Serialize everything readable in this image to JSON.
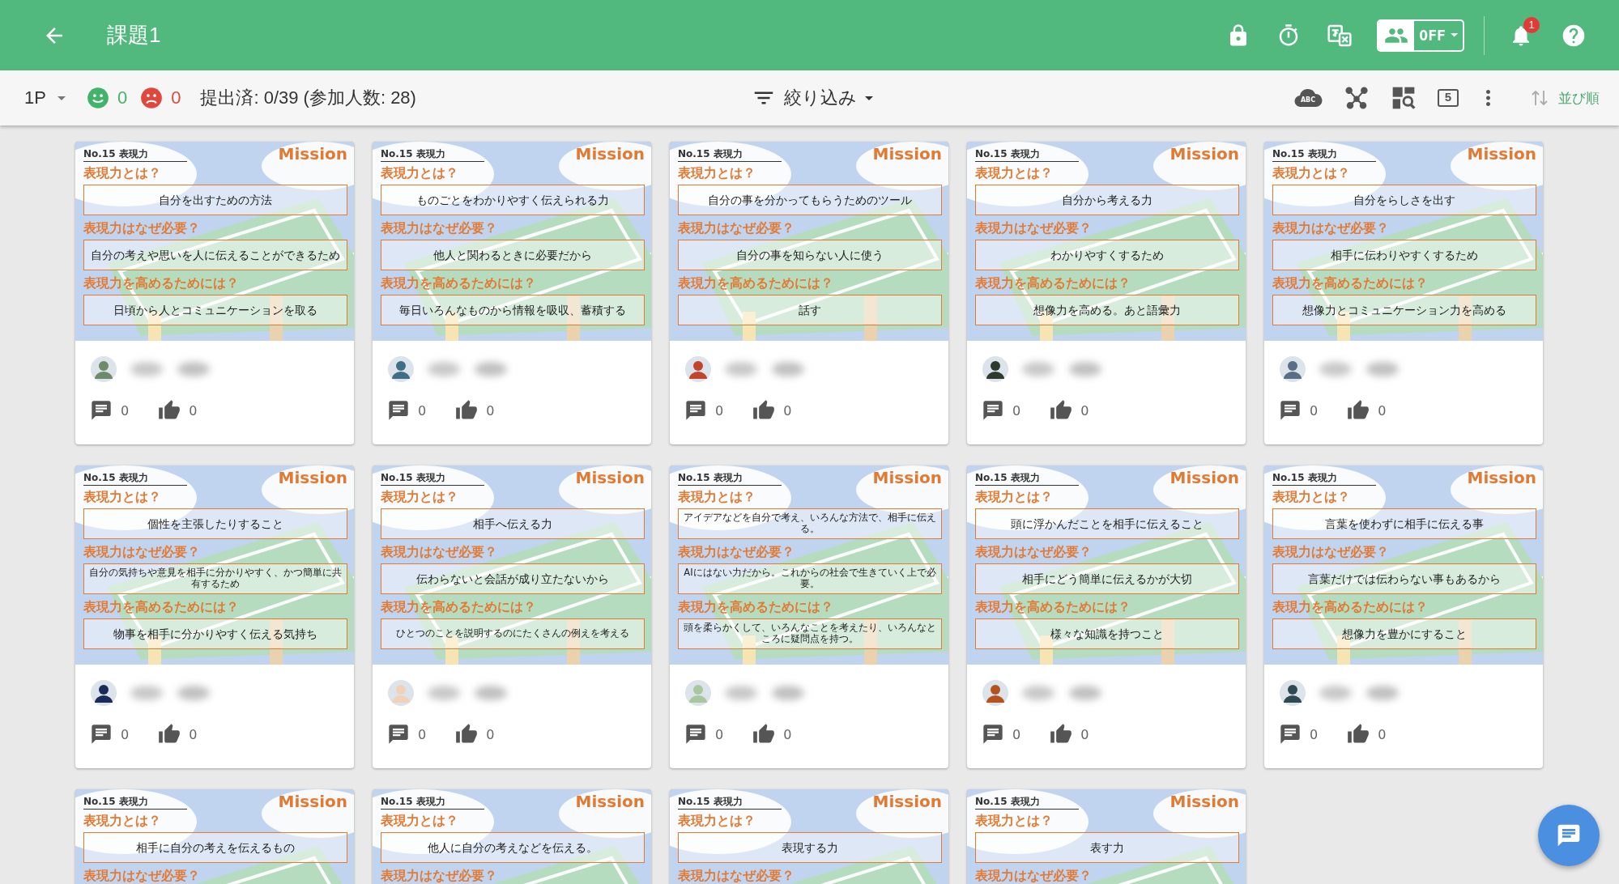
{
  "header": {
    "title": "課題1",
    "share_toggle": "OFF",
    "notification_count": "1"
  },
  "toolbar": {
    "page": "1P",
    "good_count": "0",
    "bad_count": "0",
    "submitted": "提出済: 0/39 (参加人数: 28)",
    "filter": "絞り込み",
    "spellcheck_label": "ABC",
    "columns_count": "5",
    "sort": "並び順"
  },
  "cards": [
    {
      "number": "No.15 表現力",
      "badge": "Mission",
      "sections": [
        {
          "question": "表現力とは？",
          "answer": "自分を出すための方法"
        },
        {
          "question": "表現力はなぜ必要？",
          "answer": "自分の考えや思いを人に伝えることができるため"
        },
        {
          "question": "表現力を高めるためには？",
          "answer": "日頃から人とコミュニケーションを取る"
        }
      ],
      "comments": "0",
      "likes": "0"
    },
    {
      "number": "No.15 表現力",
      "badge": "Mission",
      "sections": [
        {
          "question": "表現力とは？",
          "answer": "ものごとをわかりやすく伝えられる力"
        },
        {
          "question": "表現力はなぜ必要？",
          "answer": "他人と関わるときに必要だから"
        },
        {
          "question": "表現力を高めるためには？",
          "answer": "毎日いろんなものから情報を吸収、蓄積する"
        }
      ],
      "comments": "0",
      "likes": "0"
    },
    {
      "number": "No.15 表現力",
      "badge": "Mission",
      "sections": [
        {
          "question": "表現力とは？",
          "answer": "自分の事を分かってもらうためのツール"
        },
        {
          "question": "表現力はなぜ必要？",
          "answer": "自分の事を知らない人に使う"
        },
        {
          "question": "表現力を高めるためには？",
          "answer": "話す"
        }
      ],
      "comments": "0",
      "likes": "0"
    },
    {
      "number": "No.15 表現力",
      "badge": "Mission",
      "sections": [
        {
          "question": "表現力とは？",
          "answer": "自分から考える力"
        },
        {
          "question": "表現力はなぜ必要？",
          "answer": "わかりやすくするため"
        },
        {
          "question": "表現力を高めるためには？",
          "answer": "想像力を高める。あと語彙力"
        }
      ],
      "comments": "0",
      "likes": "0"
    },
    {
      "number": "No.15 表現力",
      "badge": "Mission",
      "sections": [
        {
          "question": "表現力とは？",
          "answer": "自分をらしさを出す"
        },
        {
          "question": "表現力はなぜ必要？",
          "answer": "相手に伝わりやすくするため"
        },
        {
          "question": "表現力を高めるためには？",
          "answer": "想像力とコミュニケーション力を高める"
        }
      ],
      "comments": "0",
      "likes": "0"
    },
    {
      "number": "No.15 表現力",
      "badge": "Mission",
      "sections": [
        {
          "question": "表現力とは？",
          "answer": "個性を主張したりすること"
        },
        {
          "question": "表現力はなぜ必要？",
          "answer": "自分の気持ちや意見を相手に分かりやすく、かつ簡単に共有するため"
        },
        {
          "question": "表現力を高めるためには？",
          "answer": "物事を相手に分かりやすく伝える気持ち"
        }
      ],
      "comments": "0",
      "likes": "0"
    },
    {
      "number": "No.15 表現力",
      "badge": "Mission",
      "sections": [
        {
          "question": "表現力とは？",
          "answer": "相手へ伝える力"
        },
        {
          "question": "表現力はなぜ必要？",
          "answer": "伝わらないと会話が成り立たないから"
        },
        {
          "question": "表現力を高めるためには？",
          "answer": "ひとつのことを説明するのにたくさんの例えを考える"
        }
      ],
      "comments": "0",
      "likes": "0"
    },
    {
      "number": "No.15 表現力",
      "badge": "Mission",
      "sections": [
        {
          "question": "表現力とは？",
          "answer": "アイデアなどを自分で考え、いろんな方法で、相手に伝える。"
        },
        {
          "question": "表現力はなぜ必要？",
          "answer": "AIにはない力だから。これからの社会で生きていく上で必要。"
        },
        {
          "question": "表現力を高めるためには？",
          "answer": "頭を柔らかくして、いろんなことを考えたり、いろんなところに疑問点を持つ。"
        }
      ],
      "comments": "0",
      "likes": "0"
    },
    {
      "number": "No.15 表現力",
      "badge": "Mission",
      "sections": [
        {
          "question": "表現力とは？",
          "answer": "頭に浮かんだことを相手に伝えること"
        },
        {
          "question": "表現力はなぜ必要？",
          "answer": "相手にどう簡単に伝えるかが大切"
        },
        {
          "question": "表現力を高めるためには？",
          "answer": "様々な知識を持つこと"
        }
      ],
      "comments": "0",
      "likes": "0"
    },
    {
      "number": "No.15 表現力",
      "badge": "Mission",
      "sections": [
        {
          "question": "表現力とは？",
          "answer": "言葉を使わずに相手に伝える事"
        },
        {
          "question": "表現力はなぜ必要？",
          "answer": "言葉だけでは伝わらない事もあるから"
        },
        {
          "question": "表現力を高めるためには？",
          "answer": "想像力を豊かにすること"
        }
      ],
      "comments": "0",
      "likes": "0"
    },
    {
      "number": "No.15 表現力",
      "badge": "Mission",
      "sections": [
        {
          "question": "表現力とは？",
          "answer": "相手に自分の考えを伝えるもの"
        },
        {
          "question": "表現力はなぜ必要？"
        }
      ]
    },
    {
      "number": "No.15 表現力",
      "badge": "Mission",
      "sections": [
        {
          "question": "表現力とは？",
          "answer": "他人に自分の考えなどを伝える。"
        },
        {
          "question": "表現力はなぜ必要？"
        }
      ]
    },
    {
      "number": "No.15 表現力",
      "badge": "Mission",
      "sections": [
        {
          "question": "表現力とは？",
          "answer": "表現する力"
        },
        {
          "question": "表現力はなぜ必要？"
        }
      ]
    },
    {
      "number": "No.15 表現力",
      "badge": "Mission",
      "sections": [
        {
          "question": "表現力とは？",
          "answer": "表す力"
        },
        {
          "question": "表現力はなぜ必要？"
        }
      ]
    }
  ]
}
